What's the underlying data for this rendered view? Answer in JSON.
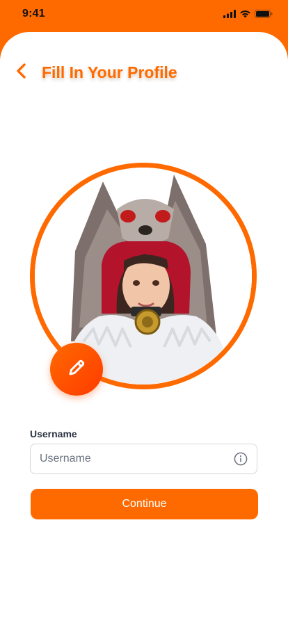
{
  "status_bar": {
    "time": "9:41",
    "icons": [
      "signal-icon",
      "wifi-icon",
      "battery-icon"
    ]
  },
  "header": {
    "title": "Fill In Your Profile",
    "back_icon": "chevron-left-icon"
  },
  "avatar": {
    "edit_icon": "pencil-icon"
  },
  "form": {
    "username_label": "Username",
    "username_value": "",
    "username_placeholder": "Username",
    "info_icon": "info-icon",
    "continue_label": "Continue"
  },
  "colors": {
    "accent": "#ff6a00",
    "accent_dark": "#ff3b00",
    "label_text": "#2b3442",
    "border": "#d1d5db"
  }
}
